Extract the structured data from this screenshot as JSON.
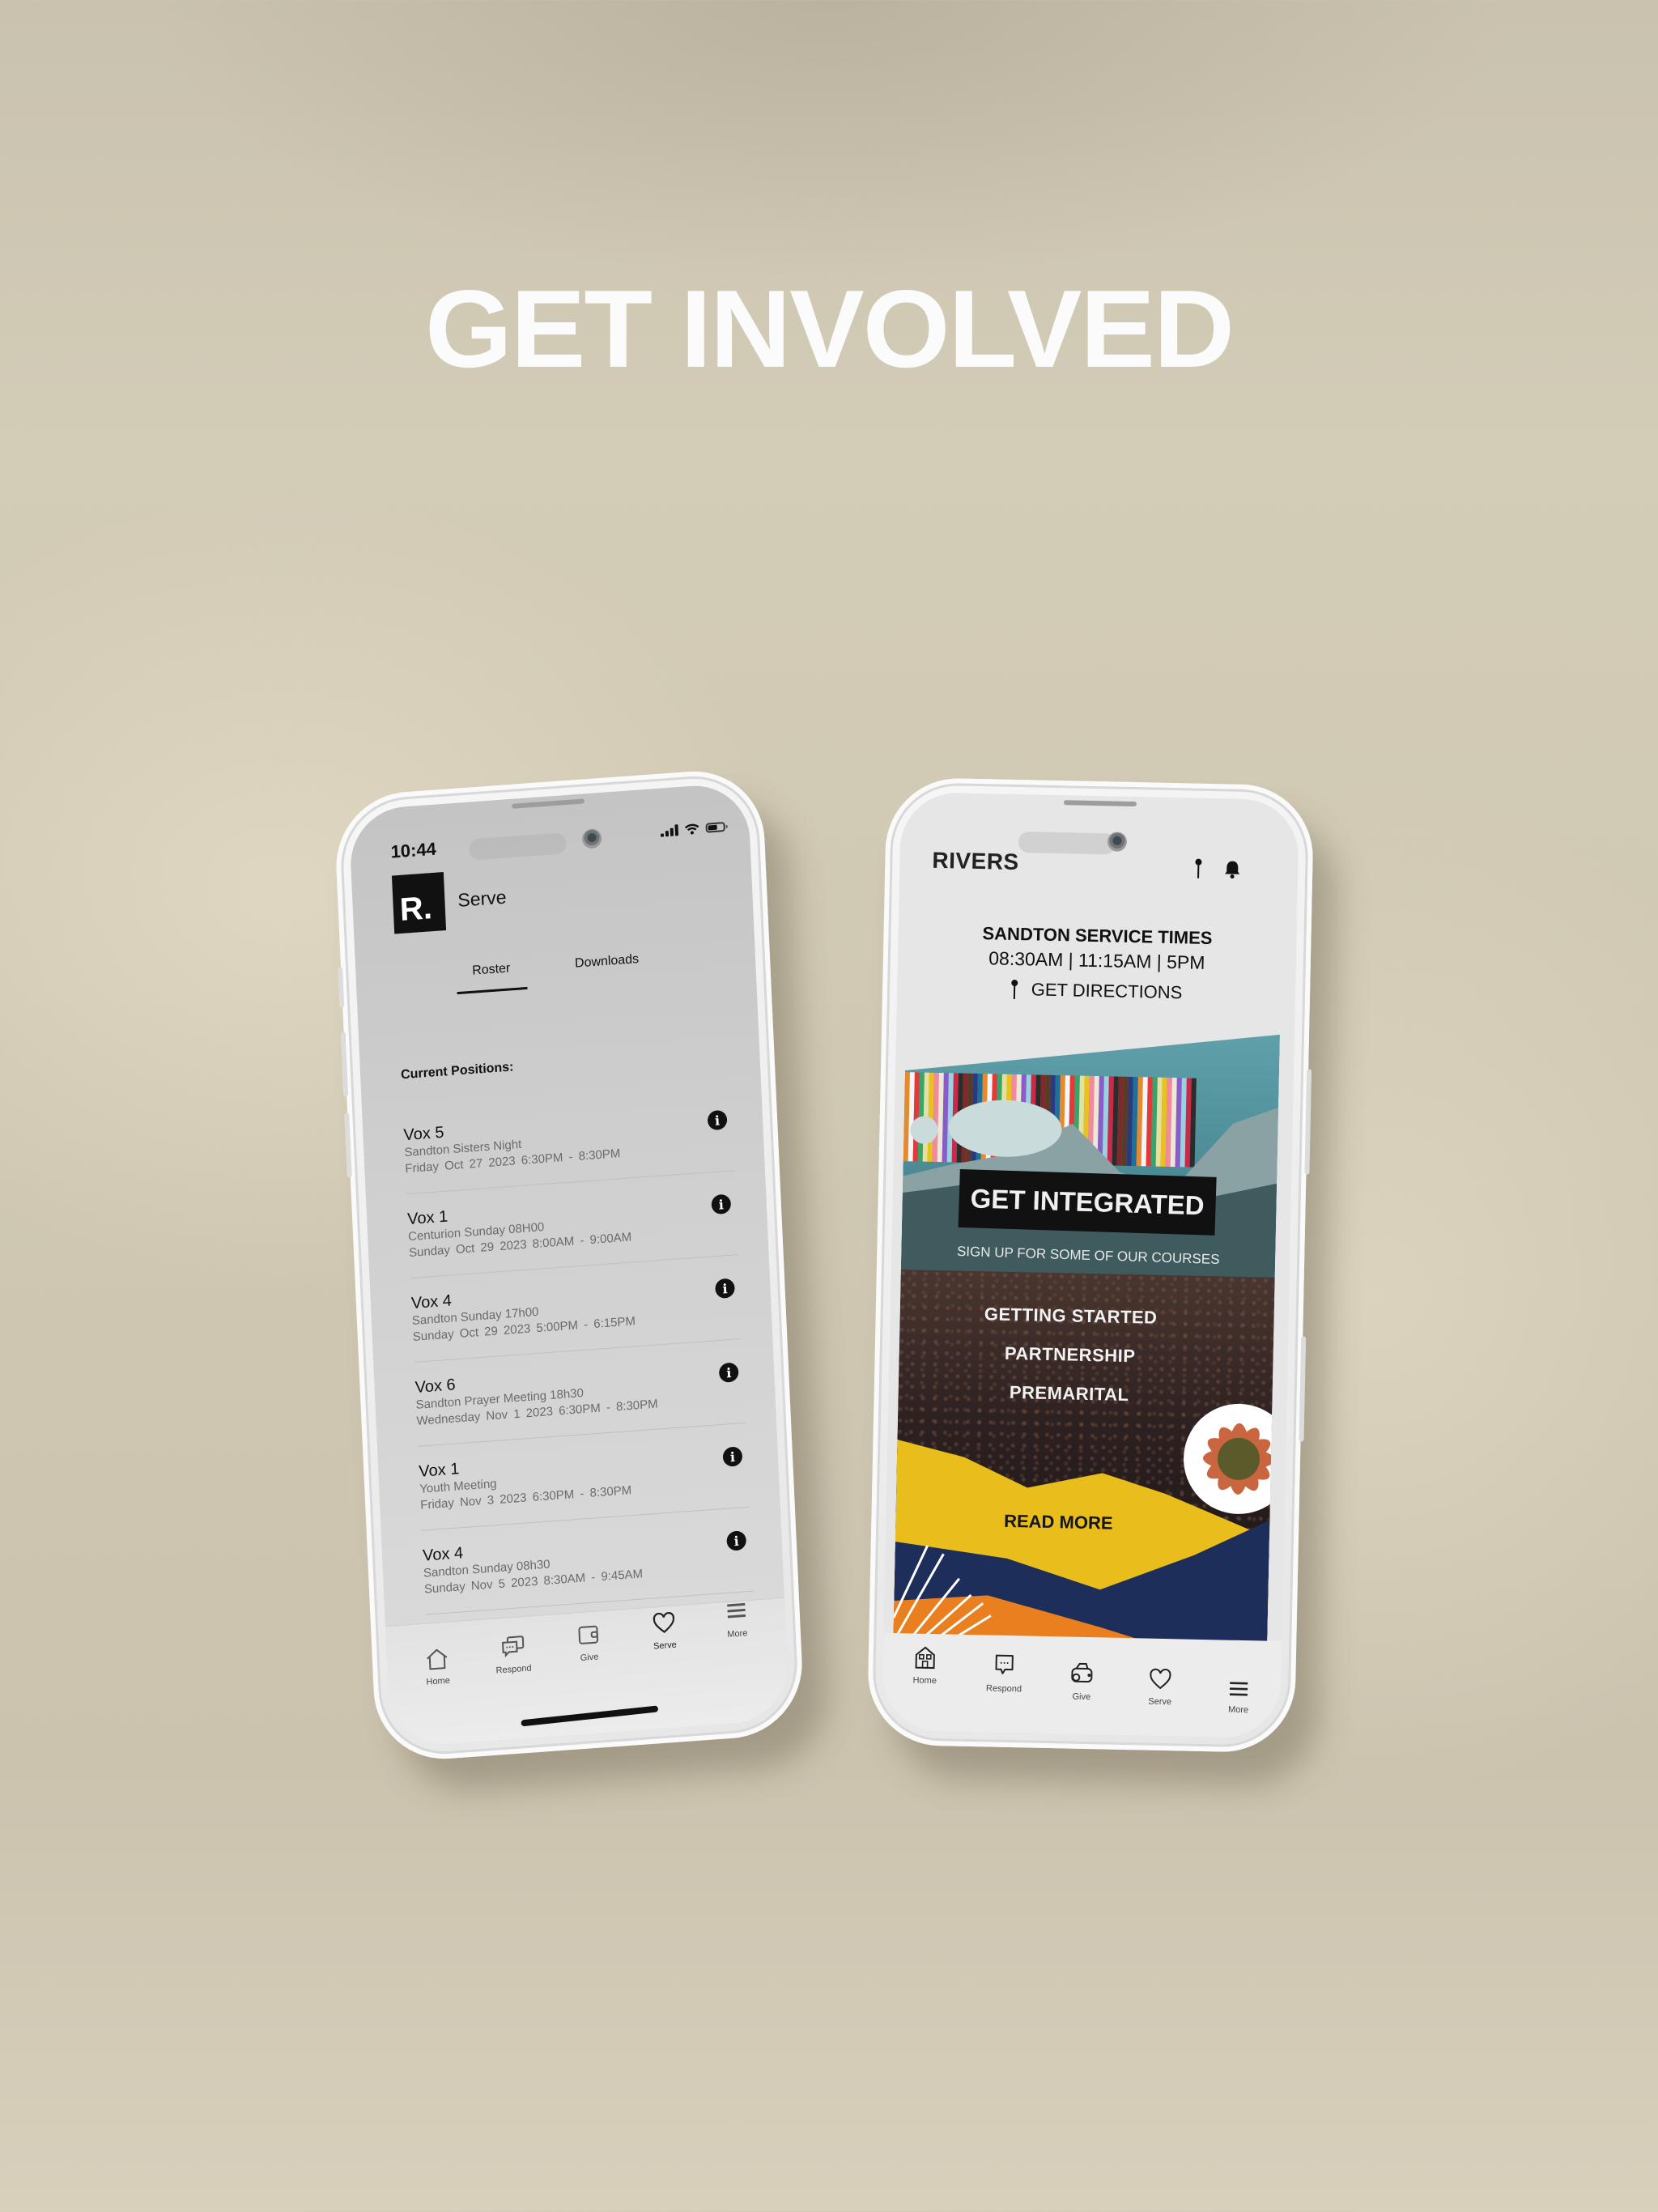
{
  "headline": "GET INVOLVED",
  "left_phone": {
    "status_bar": {
      "time": "10:44"
    },
    "header": {
      "logo_text": "R.",
      "title": "Serve"
    },
    "tabs": [
      {
        "label": "Roster",
        "active": true
      },
      {
        "label": "Downloads",
        "active": false
      }
    ],
    "section_label": "Current Positions:",
    "roster": [
      {
        "position": "Vox 5",
        "event": "Sandton Sisters Night",
        "datetime": "Friday Oct 27 2023  6:30PM -  8:30PM"
      },
      {
        "position": "Vox 1",
        "event": "Centurion Sunday 08H00",
        "datetime": "Sunday Oct 29 2023  8:00AM -  9:00AM"
      },
      {
        "position": "Vox 4",
        "event": "Sandton Sunday 17h00",
        "datetime": "Sunday Oct 29 2023  5:00PM -  6:15PM"
      },
      {
        "position": "Vox 6",
        "event": "Sandton Prayer Meeting 18h30",
        "datetime": "Wednesday Nov  1 2023  6:30PM -  8:30PM"
      },
      {
        "position": "Vox 1",
        "event": "Youth Meeting",
        "datetime": "Friday Nov  3 2023  6:30PM -  8:30PM"
      },
      {
        "position": "Vox 4",
        "event": "Sandton Sunday 08h30",
        "datetime": "Sunday Nov  5 2023  8:30AM -  9:45AM"
      }
    ],
    "tabbar": [
      {
        "label": "Home",
        "icon": "home-icon"
      },
      {
        "label": "Respond",
        "icon": "chat-icon"
      },
      {
        "label": "Give",
        "icon": "wallet-icon"
      },
      {
        "label": "Serve",
        "icon": "heart-icon",
        "active": true
      },
      {
        "label": "More",
        "icon": "menu-icon"
      }
    ]
  },
  "right_phone": {
    "header": {
      "brand": "RIVERS"
    },
    "service": {
      "title": "SANDTON SERVICE TIMES",
      "times": "08:30AM | 11:15AM | 5PM",
      "directions_label": "GET DIRECTIONS"
    },
    "banner": {
      "title": "GET INTEGRATED",
      "subtitle": "SIGN UP FOR SOME OF OUR COURSES",
      "courses": [
        "GETTING STARTED",
        "PARTNERSHIP",
        "PREMARITAL"
      ],
      "cta": "READ MORE",
      "colors": {
        "yellow": "#e8bd1c",
        "navy": "#1d2e5b",
        "orange": "#ea7f1f",
        "teal": "#4f8d97"
      }
    },
    "tabbar": [
      {
        "label": "Home",
        "icon": "home-icon"
      },
      {
        "label": "Respond",
        "icon": "chat-icon"
      },
      {
        "label": "Give",
        "icon": "wallet-icon"
      },
      {
        "label": "Serve",
        "icon": "heart-icon"
      },
      {
        "label": "More",
        "icon": "menu-icon"
      }
    ]
  }
}
